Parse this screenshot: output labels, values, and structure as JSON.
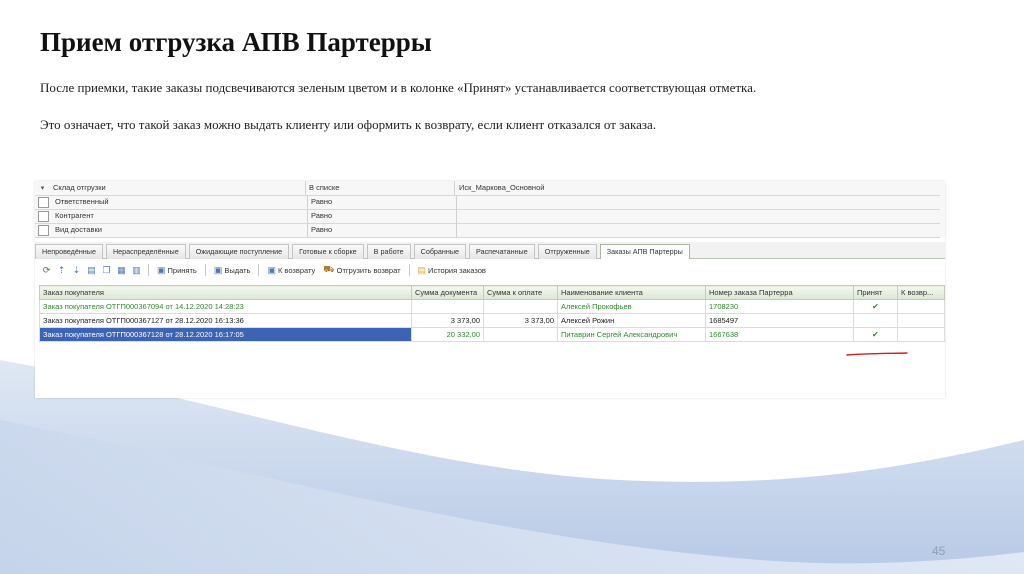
{
  "slide": {
    "title": "Прием отгрузка АПВ Партерры",
    "paragraph1": "После приемки, такие заказы подсвечиваются зеленым цветом и в колонке «Принят» устанавливается соответствующая отметка.",
    "paragraph2": "Это означает, что такой заказ можно выдать клиенту или оформить к возврату, если клиент отказался от заказа.",
    "page_number": "45"
  },
  "filters": [
    {
      "name": "Склад отгрузки",
      "condition": "В списке",
      "value": "Иск_Маркова_Основной"
    },
    {
      "name": "Ответственный",
      "condition": "Равно",
      "value": ""
    },
    {
      "name": "Контрагент",
      "condition": "Равно",
      "value": ""
    },
    {
      "name": "Вид доставки",
      "condition": "Равно",
      "value": ""
    }
  ],
  "tabs": [
    "Непроведённые",
    "Нераспределённые",
    "Ожидающие поступление",
    "Готовые к сборке",
    "В работе",
    "Собранные",
    "Распечатанные",
    "Отгруженные",
    "Заказы АПВ Партерры"
  ],
  "toolbar": {
    "accept": "Принять",
    "issue": "Выдать",
    "to_return": "К возврату",
    "ship_return": "Отгрузить возврат",
    "order_history": "История заказов"
  },
  "grid": {
    "columns": [
      "Заказ покупателя",
      "Сумма документа",
      "Сумма к оплате",
      "Наименование клиента",
      "Номер заказа Партерра",
      "Принят",
      "К возвр..."
    ],
    "rows": [
      {
        "order": "Заказ покупателя ОТГП000367094 от 14.12.2020 14:28:23",
        "doc_sum": "",
        "pay_sum": "",
        "client": "Алексей Прокофьев",
        "partner_no": "1708230",
        "accepted": "✔",
        "to_return": "",
        "style": "green"
      },
      {
        "order": "Заказ покупателя ОТГП000367127 от 28.12.2020 16:13:36",
        "doc_sum": "3 373,00",
        "pay_sum": "3 373,00",
        "client": "Алексей Рожин",
        "partner_no": "1685497",
        "accepted": "",
        "to_return": "",
        "style": "black"
      },
      {
        "order": "Заказ покупателя ОТГП000367128 от 28.12.2020 16:17:05",
        "doc_sum": "20 332,00",
        "pay_sum": "",
        "client": "Питаврин Сергей Александрович",
        "partner_no": "1667638",
        "accepted": "✔",
        "to_return": "",
        "style": "green selected"
      }
    ]
  },
  "colors": {
    "accepted_green": "#2e8a2e",
    "selection_blue": "#3c63b4",
    "annotation_red": "#d42020"
  }
}
